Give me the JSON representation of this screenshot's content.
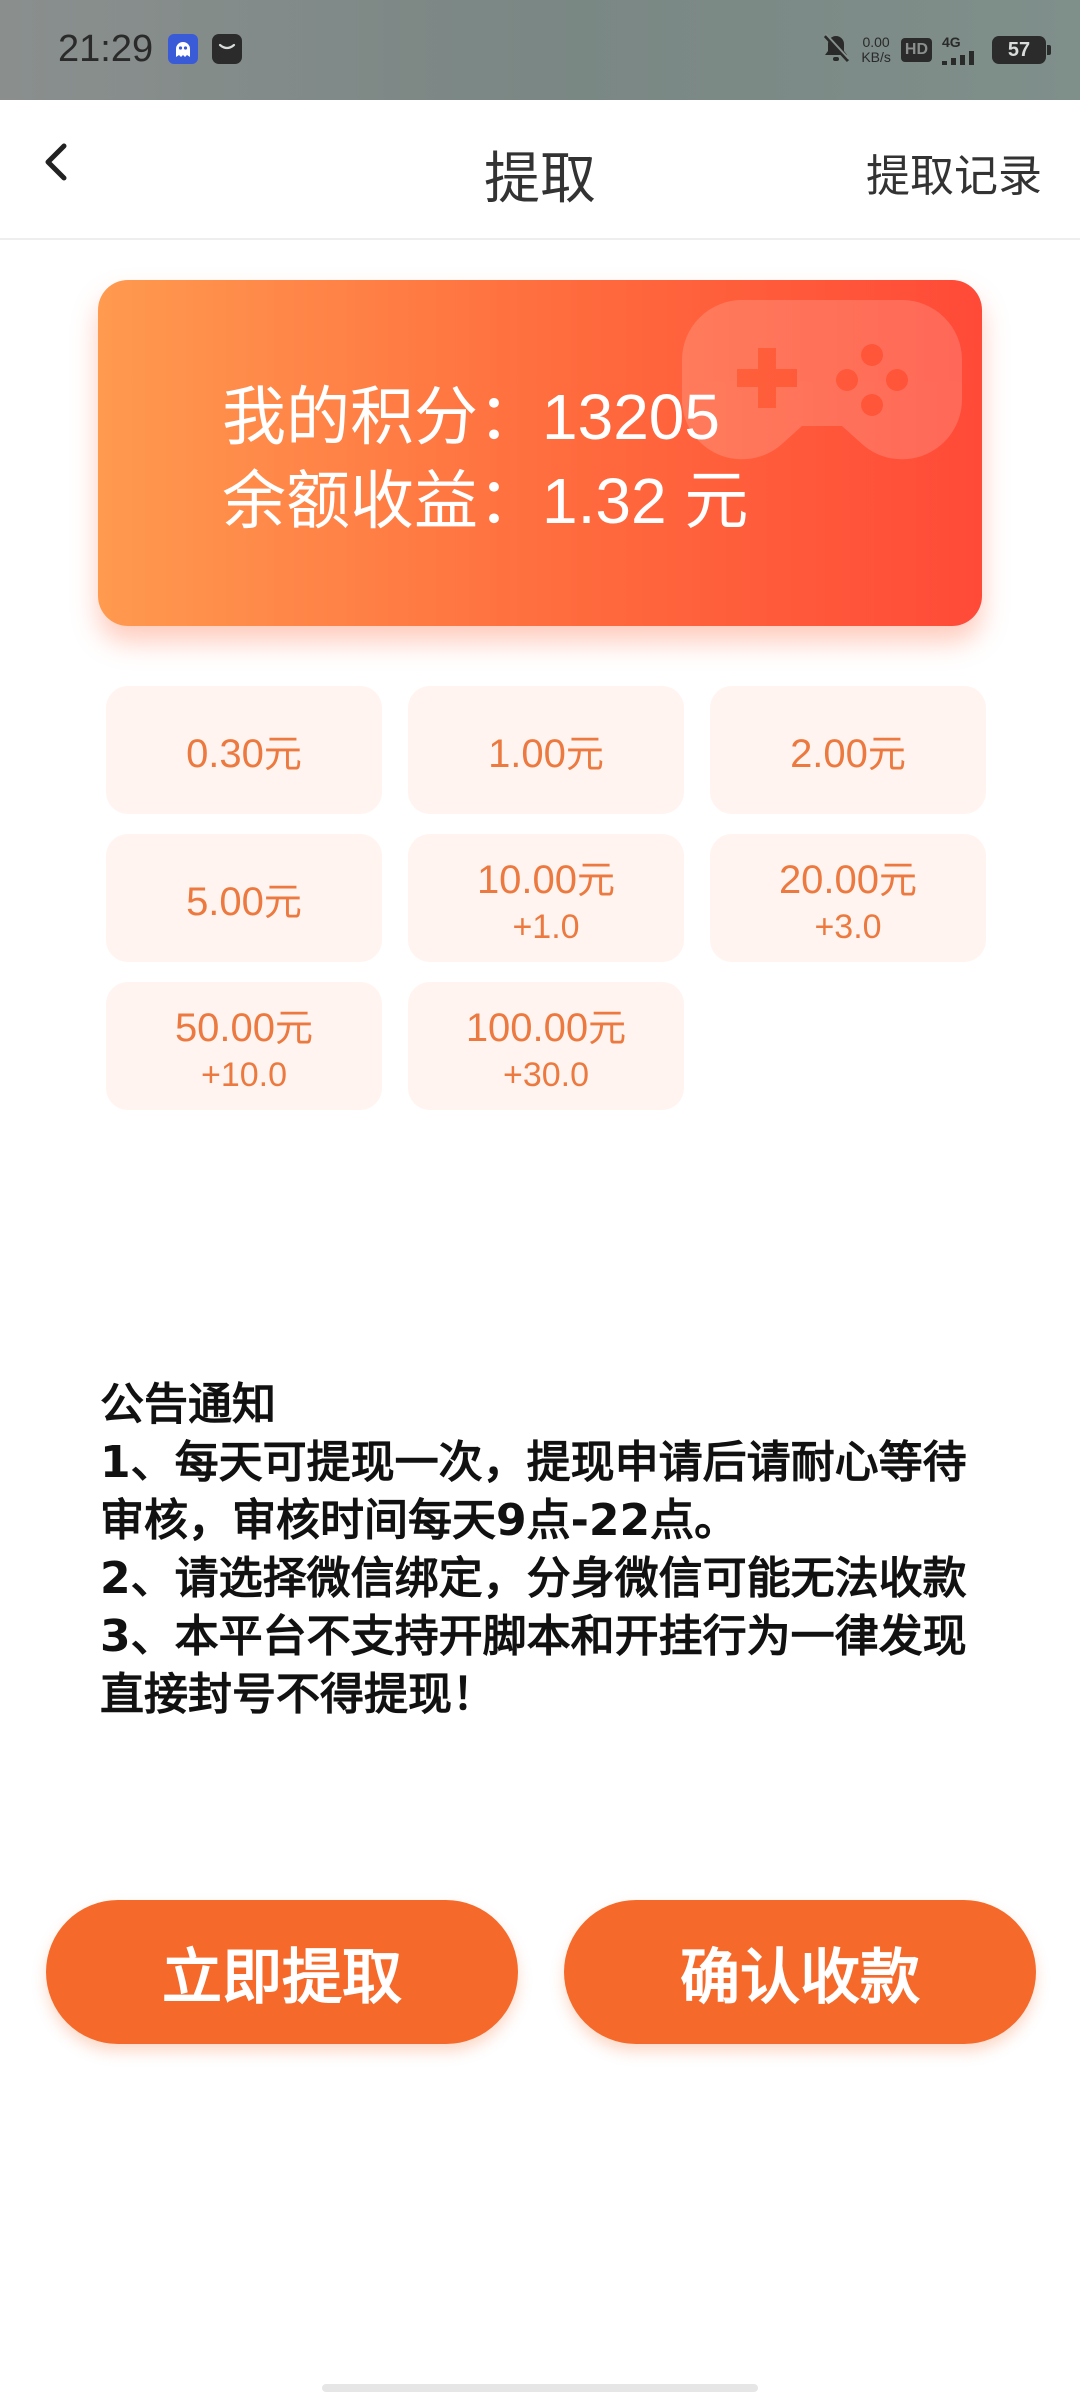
{
  "status_bar": {
    "time": "21:29",
    "net_speed_value": "0.00",
    "net_speed_unit": "KB/s",
    "hd_label": "HD",
    "network_label": "4G",
    "battery": "57"
  },
  "header": {
    "title": "提取",
    "records_label": "提取记录"
  },
  "balance_card": {
    "points_label": "我的积分：",
    "points_value": "13205",
    "balance_label": "余额收益：",
    "balance_value": "1.32 元"
  },
  "options": [
    {
      "amount": "0.30",
      "unit": "元",
      "bonus": ""
    },
    {
      "amount": "1.00",
      "unit": "元",
      "bonus": ""
    },
    {
      "amount": "2.00",
      "unit": "元",
      "bonus": ""
    },
    {
      "amount": "5.00",
      "unit": "元",
      "bonus": ""
    },
    {
      "amount": "10.00",
      "unit": "元",
      "bonus": "+1.0"
    },
    {
      "amount": "20.00",
      "unit": "元",
      "bonus": "+3.0"
    },
    {
      "amount": "50.00",
      "unit": "元",
      "bonus": "+10.0"
    },
    {
      "amount": "100.00",
      "unit": "元",
      "bonus": "+30.0"
    }
  ],
  "notice": {
    "title": "公告通知",
    "line1": "1、每天可提现一次，提现申请后请耐心等待审核，审核时间每天9点-22点。",
    "line2": "2、请选择微信绑定，分身微信可能无法收款",
    "line3": "3、本平台不支持开脚本和开挂行为一律发现直接封号不得提现！"
  },
  "actions": {
    "withdraw_now": "立即提取",
    "confirm_receipt": "确认收款"
  },
  "colors": {
    "accent": "#f56a2a",
    "card_start": "#ff9a4f",
    "card_end": "#ff4a38",
    "option_bg": "#fff4ef",
    "option_text": "#ec7a40"
  }
}
